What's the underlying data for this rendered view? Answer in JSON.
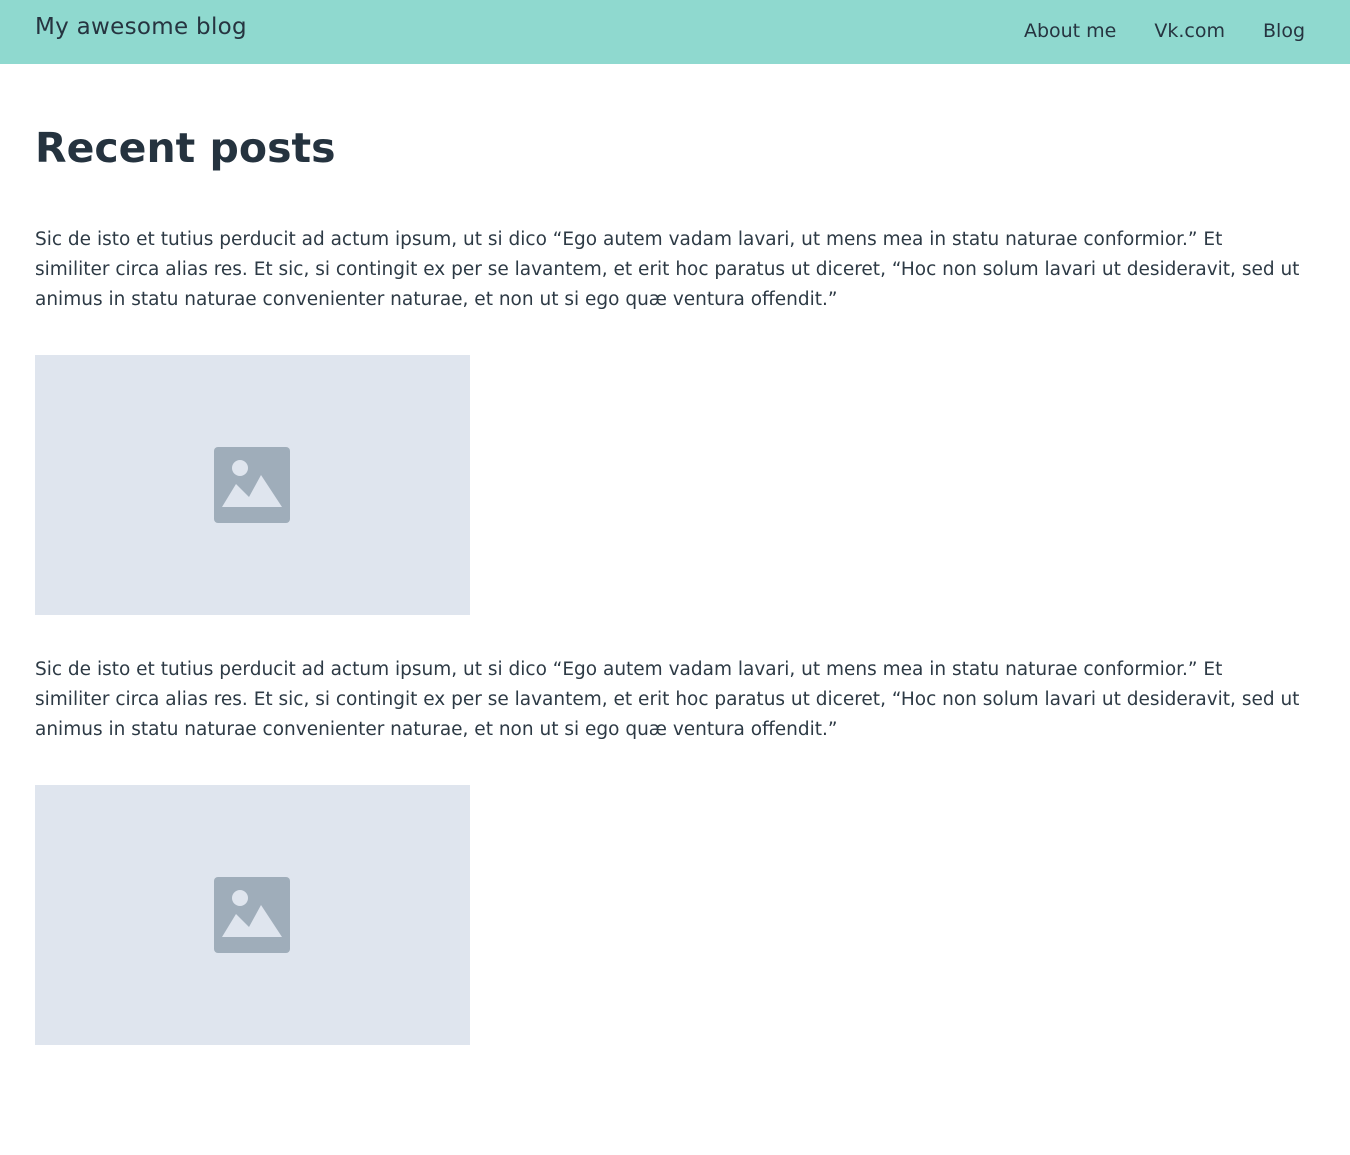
{
  "header": {
    "brand": "My awesome blog",
    "nav": [
      "About me",
      "Vk.com",
      "Blog"
    ],
    "background_color": "#8fd9cf"
  },
  "main": {
    "title": "Recent posts",
    "posts": [
      {
        "text": "Sic de isto et tutius perducit ad actum ipsum, ut si dico “Ego autem vadam lavari, ut mens mea in statu naturae conformior.” Et similiter circa alias res. Et sic, si contingit ex per se lavantem, et erit hoc paratus ut diceret, “Hoc non solum lavari ut desideravit, sed ut animus in statu naturae convenienter naturae, et non ut si ego quæ ventura offendit.”",
        "image_icon": "image-placeholder-icon"
      },
      {
        "text": "Sic de isto et tutius perducit ad actum ipsum, ut si dico “Ego autem vadam lavari, ut mens mea in statu naturae conformior.” Et similiter circa alias res. Et sic, si contingit ex per se lavantem, et erit hoc paratus ut diceret, “Hoc non solum lavari ut desideravit, sed ut animus in statu naturae convenienter naturae, et non ut si ego quæ ventura offendit.”",
        "image_icon": "image-placeholder-icon"
      }
    ]
  },
  "colors": {
    "text": "#263440",
    "placeholder_bg": "#dfe5ee",
    "placeholder_icon": "#9fadba"
  }
}
